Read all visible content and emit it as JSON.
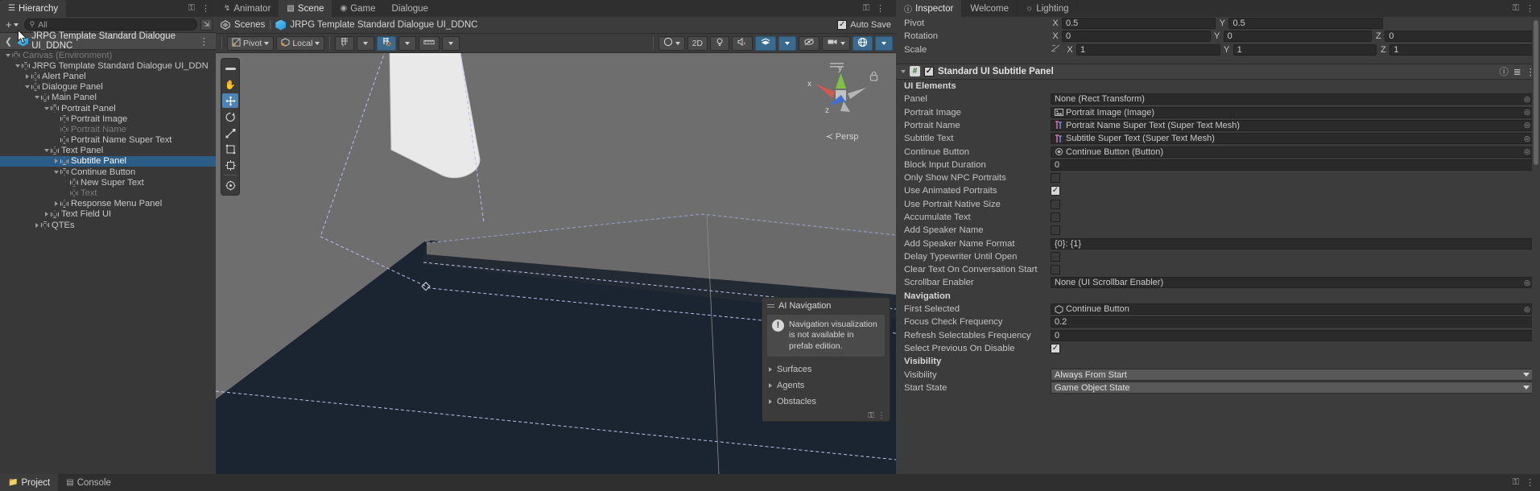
{
  "hierarchy": {
    "tab_label": "Hierarchy",
    "tab_icon": "hierarchy-icon",
    "add_label": "+",
    "search_placeholder": "All",
    "prefab_name": "JRPG Template Standard Dialogue UI_DDNC",
    "items": [
      {
        "label": "Canvas (Environment)",
        "indent": 0,
        "twirl": "down",
        "dim": true,
        "selected": false
      },
      {
        "label": "JRPG Template Standard Dialogue UI_DDN",
        "indent": 1,
        "twirl": "down",
        "dim": false,
        "selected": false
      },
      {
        "label": "Alert Panel",
        "indent": 2,
        "twirl": "right",
        "dim": false,
        "selected": false
      },
      {
        "label": "Dialogue Panel",
        "indent": 2,
        "twirl": "down",
        "dim": false,
        "selected": false
      },
      {
        "label": "Main Panel",
        "indent": 3,
        "twirl": "down",
        "dim": false,
        "selected": false
      },
      {
        "label": "Portrait Panel",
        "indent": 4,
        "twirl": "down",
        "dim": false,
        "selected": false
      },
      {
        "label": "Portrait Image",
        "indent": 5,
        "twirl": "none",
        "dim": false,
        "selected": false
      },
      {
        "label": "Portrait Name",
        "indent": 5,
        "twirl": "none",
        "dim": true,
        "selected": false
      },
      {
        "label": "Portrait Name Super Text",
        "indent": 5,
        "twirl": "none",
        "dim": false,
        "selected": false
      },
      {
        "label": "Text Panel",
        "indent": 4,
        "twirl": "down",
        "dim": false,
        "selected": false
      },
      {
        "label": "Subtitle Panel",
        "indent": 5,
        "twirl": "right",
        "dim": false,
        "selected": true
      },
      {
        "label": "Continue Button",
        "indent": 5,
        "twirl": "down",
        "dim": false,
        "selected": false
      },
      {
        "label": "New Super Text",
        "indent": 6,
        "twirl": "none",
        "dim": false,
        "selected": false
      },
      {
        "label": "Text",
        "indent": 6,
        "twirl": "none",
        "dim": true,
        "selected": false
      },
      {
        "label": "Response Menu Panel",
        "indent": 5,
        "twirl": "right",
        "dim": false,
        "selected": false
      },
      {
        "label": "Text Field UI",
        "indent": 4,
        "twirl": "right",
        "dim": false,
        "selected": false
      },
      {
        "label": "QTEs",
        "indent": 3,
        "twirl": "right",
        "dim": false,
        "selected": false
      }
    ]
  },
  "scene": {
    "tabs": [
      {
        "label": "Animator",
        "icon": "animator-icon",
        "active": false
      },
      {
        "label": "Scene",
        "icon": "grid-icon",
        "active": true
      },
      {
        "label": "Game",
        "icon": "gamepad-icon",
        "active": false
      },
      {
        "label": "Dialogue",
        "icon": "none",
        "active": false
      }
    ],
    "breadcrumb_root": "Scenes",
    "breadcrumb_sep": "|",
    "breadcrumb_current": "JRPG Template Standard Dialogue UI_DDNC",
    "auto_save_label": "Auto Save",
    "auto_save_checked": true,
    "toolbar": {
      "pivot_label": "Pivot",
      "handle_label": "Local",
      "grid_icon": "grid-snap-icon",
      "snap_icon": "snap-increment-icon",
      "ruler_icon": "ruler-icon",
      "audio_icon": "audio-mute-icon",
      "fx_icon": "effects-icon",
      "hidden_icon": "hidden-objects-icon",
      "camera_icon": "scene-camera-icon",
      "gizmos_icon": "gizmos-icon",
      "draw_mode_icon": "shading-mode-icon",
      "mode_2d_label": "2D",
      "light_icon": "scene-lighting-icon"
    },
    "tools": [
      "hand-tool",
      "move-tool",
      "rotate-tool",
      "scale-tool",
      "rect-tool",
      "transform-tool",
      "custom-tool"
    ],
    "gizmo": {
      "x_label": "x",
      "y_label": "y",
      "z_label": "z",
      "persp_label": "Persp",
      "lock_icon": "lock-icon"
    },
    "ai_navigation": {
      "title": "AI Navigation",
      "warning": "Navigation visualization is not available in prefab edition.",
      "warning_icon": "info-icon",
      "sections": [
        "Surfaces",
        "Agents",
        "Obstacles"
      ]
    }
  },
  "inspector": {
    "tabs": [
      {
        "label": "Inspector",
        "icon": "info-icon",
        "active": true
      },
      {
        "label": "Welcome",
        "icon": "none",
        "active": false
      },
      {
        "label": "Lighting",
        "icon": "bulb-icon",
        "active": false
      }
    ],
    "transform": [
      {
        "label": "Pivot",
        "axes": [
          {
            "k": "X",
            "v": "0.5"
          },
          {
            "k": "Y",
            "v": "0.5"
          }
        ],
        "lock": false
      },
      {
        "label": "Rotation",
        "axes": [
          {
            "k": "X",
            "v": "0"
          },
          {
            "k": "Y",
            "v": "0"
          },
          {
            "k": "Z",
            "v": "0"
          }
        ],
        "lock": false
      },
      {
        "label": "Scale",
        "axes": [
          {
            "k": "X",
            "v": "1"
          },
          {
            "k": "Y",
            "v": "1"
          },
          {
            "k": "Z",
            "v": "1"
          }
        ],
        "lock": true
      }
    ],
    "component": {
      "title": "Standard UI Subtitle Panel",
      "enabled": true,
      "script_icon": "script-icon",
      "help_icon": "help-icon",
      "preset_icon": "preset-icon",
      "menu_icon": "kebab-menu-icon"
    },
    "groups": [
      {
        "header": "UI Elements",
        "rows": [
          {
            "label": "Panel",
            "type": "object",
            "value": "None (Rect Transform)",
            "icon": "none"
          },
          {
            "label": "Portrait Image",
            "type": "object",
            "value": "Portrait Image (Image)",
            "icon": "image-icon"
          },
          {
            "label": "Portrait Name",
            "type": "object",
            "value": "Portrait Name Super Text (Super Text Mesh)",
            "icon": "text-icon"
          },
          {
            "label": "Subtitle Text",
            "type": "object",
            "value": "Subtitle Super Text (Super Text Mesh)",
            "icon": "text-icon"
          },
          {
            "label": "Continue Button",
            "type": "object",
            "value": "Continue Button (Button)",
            "icon": "button-icon"
          },
          {
            "label": "Block Input Duration",
            "type": "text",
            "value": "0"
          },
          {
            "label": "Only Show NPC Portraits",
            "type": "checkbox",
            "value": false
          },
          {
            "label": "Use Animated Portraits",
            "type": "checkbox",
            "value": true
          },
          {
            "label": "Use Portrait Native Size",
            "type": "checkbox",
            "value": false
          },
          {
            "label": "Accumulate Text",
            "type": "checkbox",
            "value": false
          },
          {
            "label": "Add Speaker Name",
            "type": "checkbox",
            "value": false
          },
          {
            "label": "Add Speaker Name Format",
            "type": "text",
            "value": "{0}: {1}"
          },
          {
            "label": "Delay Typewriter Until Open",
            "type": "checkbox",
            "value": false
          },
          {
            "label": "Clear Text On Conversation Start",
            "type": "checkbox",
            "value": false
          },
          {
            "label": "Scrollbar Enabler",
            "type": "object",
            "value": "None (UI Scrollbar Enabler)",
            "icon": "none"
          }
        ]
      },
      {
        "header": "Navigation",
        "rows": [
          {
            "label": "First Selected",
            "type": "object",
            "value": "Continue Button",
            "icon": "gameobject-icon"
          },
          {
            "label": "Focus Check Frequency",
            "type": "text",
            "value": "0.2"
          },
          {
            "label": "Refresh Selectables Frequency",
            "type": "text",
            "value": "0"
          },
          {
            "label": "Select Previous On Disable",
            "type": "checkbox",
            "value": true
          }
        ]
      },
      {
        "header": "Visibility",
        "rows": [
          {
            "label": "Visibility",
            "type": "popup",
            "value": "Always From Start"
          },
          {
            "label": "Start State",
            "type": "popup",
            "value": "Game Object State"
          }
        ]
      }
    ]
  },
  "bottom_tabs": [
    {
      "label": "Project",
      "icon": "folder-icon",
      "active": true
    },
    {
      "label": "Console",
      "icon": "console-icon",
      "active": false
    }
  ],
  "colors": {
    "selection_blue": "#2c5d87",
    "accent_blue": "#4c84b5",
    "panel_bg": "#383838",
    "header_bg": "#3c3c3c",
    "viewport_bg": "#6e6e6e"
  }
}
